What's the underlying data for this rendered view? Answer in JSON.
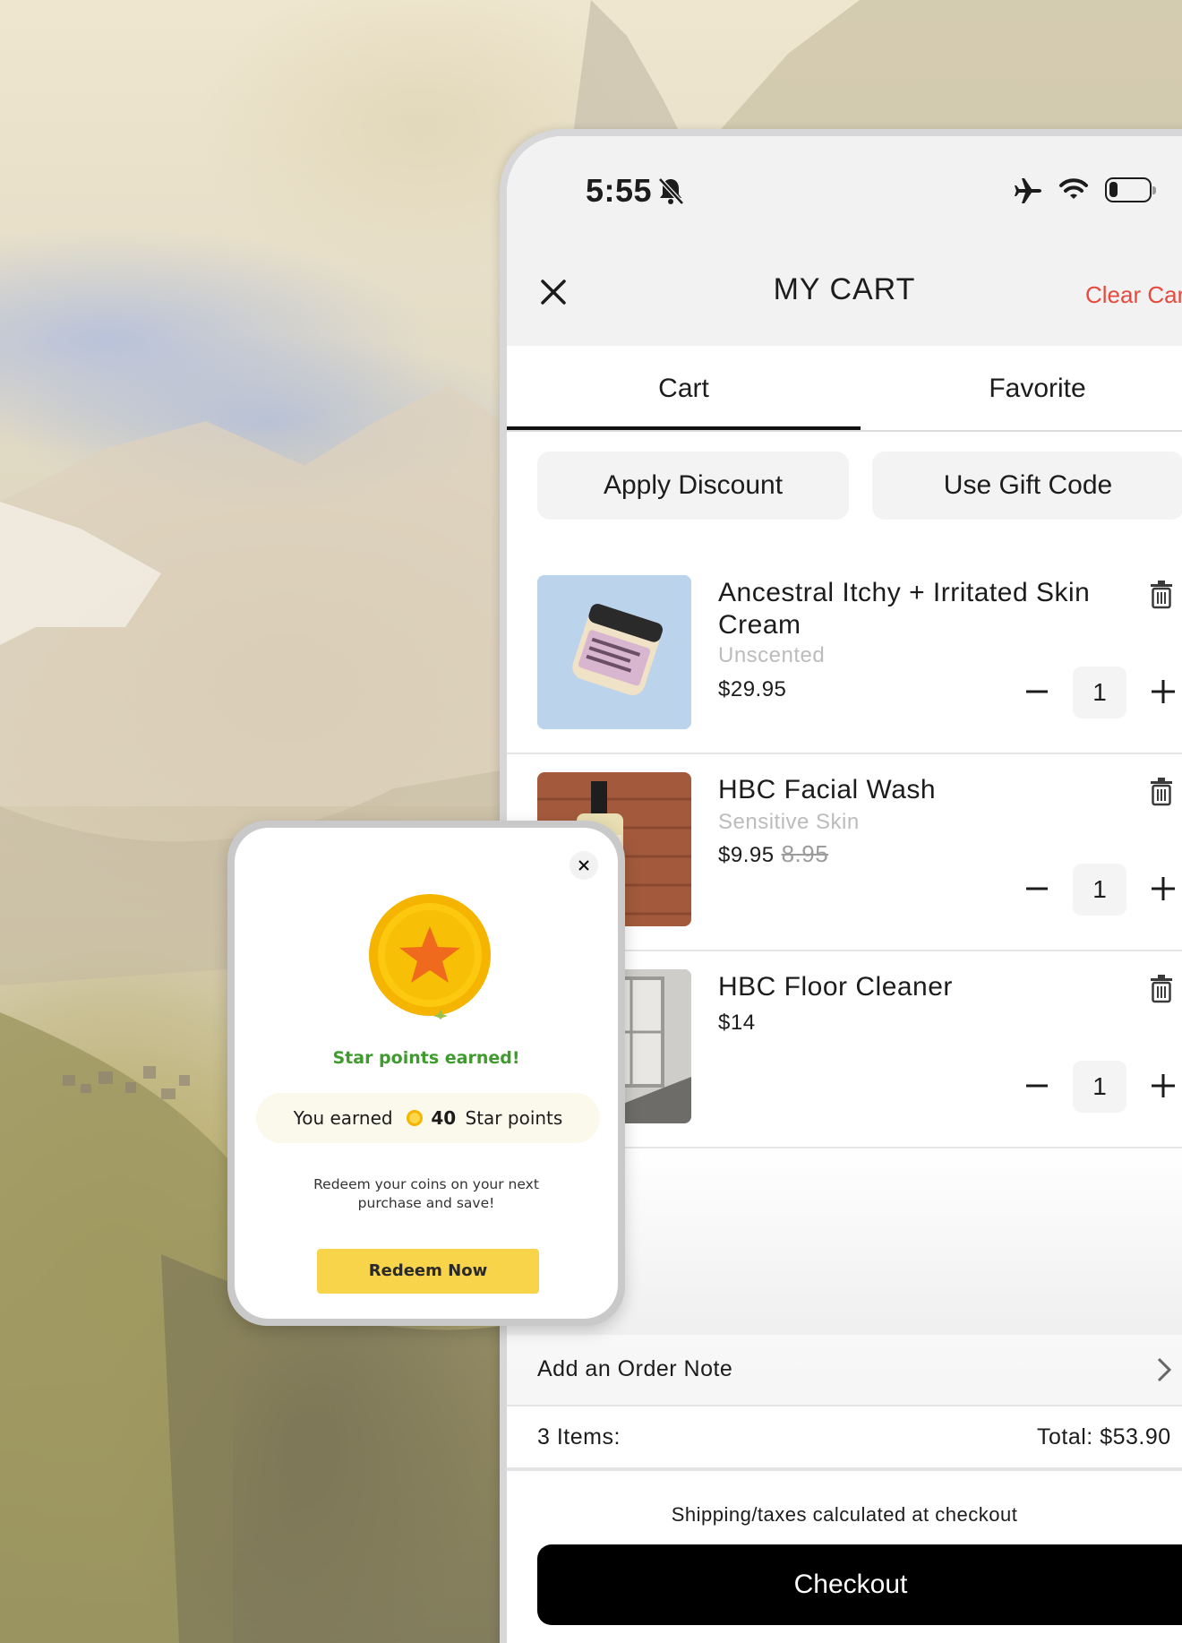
{
  "status_bar": {
    "time": "5:55"
  },
  "header": {
    "title": "MY CART",
    "clear_label": "Clear Cart"
  },
  "tabs": [
    {
      "label": "Cart",
      "active": true
    },
    {
      "label": "Favorite",
      "active": false
    }
  ],
  "actions": {
    "discount_label": "Apply Discount",
    "gift_label": "Use Gift Code"
  },
  "items": [
    {
      "name": "Ancestral Itchy + Irritated Skin Cream",
      "variant": "Unscented",
      "price": "$29.95",
      "old_price": "",
      "quantity": "1"
    },
    {
      "name": "HBC Facial Wash",
      "variant": "Sensitive Skin",
      "price": "$9.95",
      "old_price": "8.95",
      "quantity": "1"
    },
    {
      "name": "HBC Floor Cleaner",
      "variant": "",
      "price": "$14",
      "old_price": "",
      "quantity": "1"
    }
  ],
  "footer": {
    "order_note_label": "Add an Order Note",
    "items_count": "3 Items:",
    "total": "Total:  $53.90",
    "shipping_note": "Shipping/taxes calculated at checkout",
    "checkout_label": "Checkout"
  },
  "popup": {
    "title": "Star points earned!",
    "earned_prefix": "You earned",
    "points": "40",
    "earned_suffix": "Star points",
    "message": "Redeem your coins on your next purchase and save!",
    "button_label": "Redeem Now"
  },
  "colors": {
    "accent_red": "#e64a3c",
    "popup_green": "#3f9b2d",
    "redeem_yellow": "#f8d44a",
    "checkout_black": "#000000"
  }
}
